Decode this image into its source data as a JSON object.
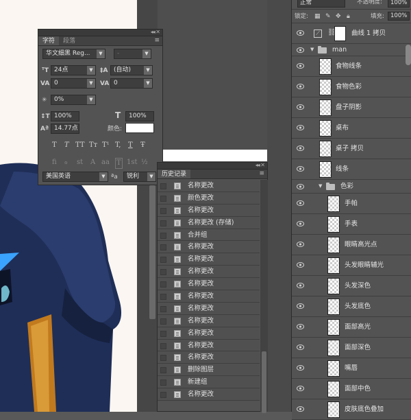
{
  "character_panel": {
    "tabs": [
      "字符",
      "段落"
    ],
    "font_family": "华文细黑 Reg...",
    "font_style": "-",
    "font_size": "24点",
    "leading": "(自动)",
    "kerning": "0",
    "tracking": "0",
    "tsume": "0%",
    "vertical_scale": "100%",
    "horizontal_scale": "100%",
    "baseline_shift": "14.77点",
    "color_label": "颜色:",
    "color_value": "#ffffff",
    "format_buttons": [
      "T",
      "T",
      "TT",
      "Tт",
      "T¹",
      "T,",
      "T",
      "Ŧ"
    ],
    "opentype_buttons": [
      "fi",
      "ℴ",
      "st",
      "A",
      "aa",
      "T",
      "1st",
      "½"
    ],
    "language": "美国英语",
    "aa_icon": "ªa",
    "antialias": "锐利"
  },
  "history_panel": {
    "title": "历史记录",
    "items": [
      "名称更改",
      "颜色更改",
      "名称更改",
      "名称更改 (存储)",
      "合并组",
      "名称更改",
      "名称更改",
      "名称更改",
      "名称更改",
      "名称更改",
      "名称更改",
      "名称更改",
      "名称更改",
      "名称更改",
      "名称更改",
      "删除图层",
      "新建组",
      "名称更改"
    ]
  },
  "layers_panel": {
    "blend_mode": "正常",
    "opacity_label": "不透明度:",
    "opacity": "100%",
    "lock_label": "锁定:",
    "fill_label": "填充:",
    "fill": "100%",
    "adjustment_layer": "曲线 1 拷贝",
    "group_man": "man",
    "layers_a": [
      "食物线条",
      "食物色彩",
      "盘子阴影",
      "桌布",
      "桌子 拷贝",
      "线条"
    ],
    "group_color": "色彩",
    "layers_b": [
      "手帕",
      "手表",
      "眼睛高光点",
      "头发眼睛辅光",
      "头发深色",
      "头发底色",
      "面部高光",
      "面部深色",
      "嘴唇",
      "面部中色",
      "皮肤底色叠加"
    ]
  },
  "colors": {
    "panel_bg": "#535353",
    "canvas_bg": "#fbf6f1",
    "suit": "#1f2e57",
    "accent_blue": "#3aa3ff",
    "chair": "#c17a1e"
  }
}
